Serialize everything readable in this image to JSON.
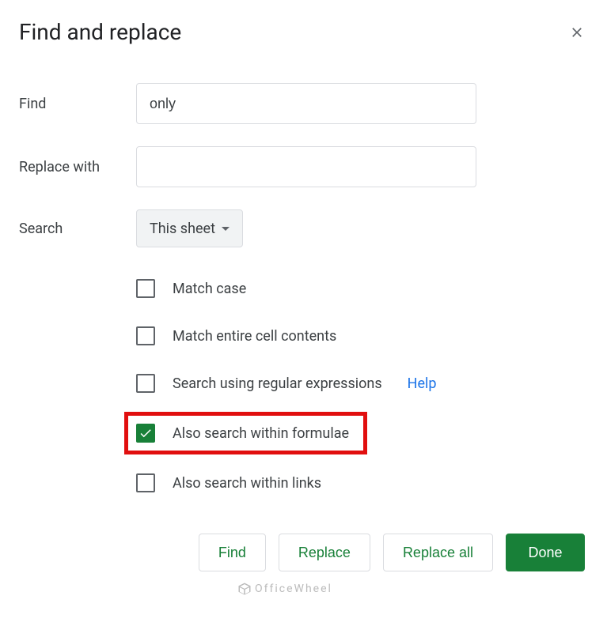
{
  "title": "Find and replace",
  "labels": {
    "find": "Find",
    "replace_with": "Replace with",
    "search": "Search"
  },
  "inputs": {
    "find_value": "only",
    "replace_value": ""
  },
  "dropdown": {
    "selected": "This sheet"
  },
  "checkboxes": {
    "match_case": {
      "label": "Match case",
      "checked": false
    },
    "match_entire": {
      "label": "Match entire cell contents",
      "checked": false
    },
    "regex": {
      "label": "Search using regular expressions",
      "checked": false,
      "help": "Help"
    },
    "formulae": {
      "label": "Also search within formulae",
      "checked": true
    },
    "links": {
      "label": "Also search within links",
      "checked": false
    }
  },
  "buttons": {
    "find": "Find",
    "replace": "Replace",
    "replace_all": "Replace all",
    "done": "Done"
  },
  "watermark": "OfficeWheel"
}
